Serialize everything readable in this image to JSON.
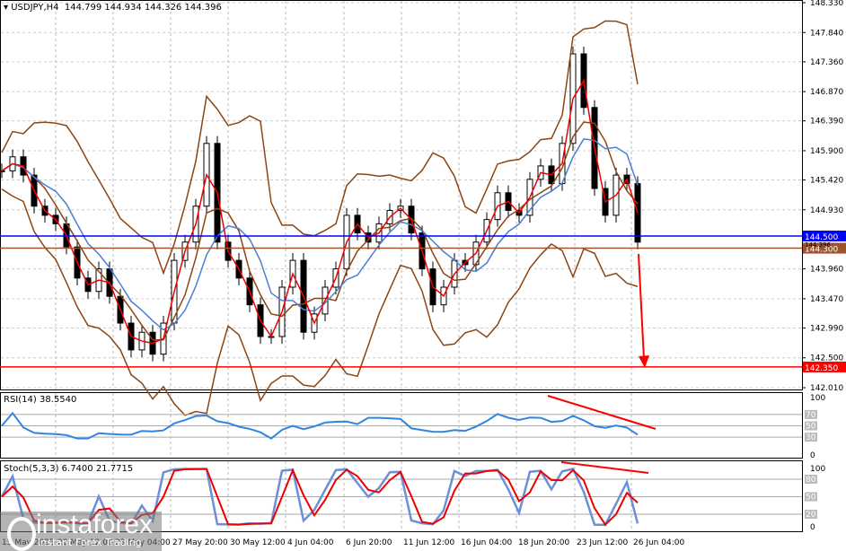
{
  "chart_data": {
    "type": "candlestick",
    "title": "USDJPY,H4",
    "ohlc_header": "144.799 144.934 144.326 144.396",
    "symbol": "USDJPY",
    "timeframe": "H4",
    "open": 144.799,
    "high": 144.934,
    "low": 144.326,
    "close": 144.396,
    "ylim": [
      142.01,
      148.33
    ],
    "price_ticks": [
      "148.330",
      "147.840",
      "147.360",
      "146.870",
      "146.390",
      "145.900",
      "145.420",
      "144.930",
      "143.960",
      "143.470",
      "142.990",
      "142.500",
      "142.010"
    ],
    "time_ticks": [
      "15 May 2025",
      "20 May 12:00",
      "23 May 04:00",
      "27 May 20:00",
      "30 May 12:00",
      "4 Jun 04:00",
      "6 Jun 20:00",
      "11 Jun 12:00",
      "16 Jun 04:00",
      "18 Jun 20:00",
      "23 Jun 12:00",
      "26 Jun 04:00"
    ],
    "closes": [
      145.57,
      145.8,
      145.5,
      144.99,
      144.84,
      144.7,
      144.32,
      143.81,
      143.59,
      143.96,
      143.51,
      143.07,
      142.63,
      142.92,
      142.56,
      143.07,
      144.1,
      144.4,
      144.99,
      146.02,
      144.4,
      144.1,
      143.81,
      143.37,
      142.85,
      142.85,
      143.66,
      144.1,
      142.92,
      143.22,
      143.66,
      143.96,
      144.84,
      144.55,
      144.4,
      144.7,
      144.92,
      144.99,
      144.55,
      143.96,
      143.37,
      143.66,
      144.1,
      144.03,
      144.4,
      144.77,
      145.21,
      144.92,
      144.84,
      145.43,
      145.65,
      145.36,
      146.02,
      147.49,
      146.61,
      145.28,
      144.84,
      145.5,
      145.36,
      144.4
    ],
    "levels": [
      {
        "label": "144.500",
        "value": 144.5,
        "color": "#0000ff"
      },
      {
        "label": "144.300",
        "value": 144.3,
        "color": "#a0522d"
      },
      {
        "label": "142.350",
        "value": 142.35,
        "color": "#ff0000"
      }
    ],
    "current_price_label": "144.396",
    "indicators": {
      "rsi": {
        "label": "RSI(14) 38.5540",
        "value": 38.554,
        "levels": [
          "70",
          "50",
          "30"
        ],
        "scale": [
          "100",
          "0"
        ]
      },
      "stoch": {
        "label": "Stoch(5,3,3) 6.7400 21.7715",
        "main": 6.74,
        "signal": 21.7715,
        "levels": [
          "80",
          "50",
          "20"
        ],
        "scale": [
          "100",
          "0"
        ]
      }
    }
  },
  "watermark": {
    "brand": "instaforex",
    "tagline": "Instant Forex Trading"
  }
}
